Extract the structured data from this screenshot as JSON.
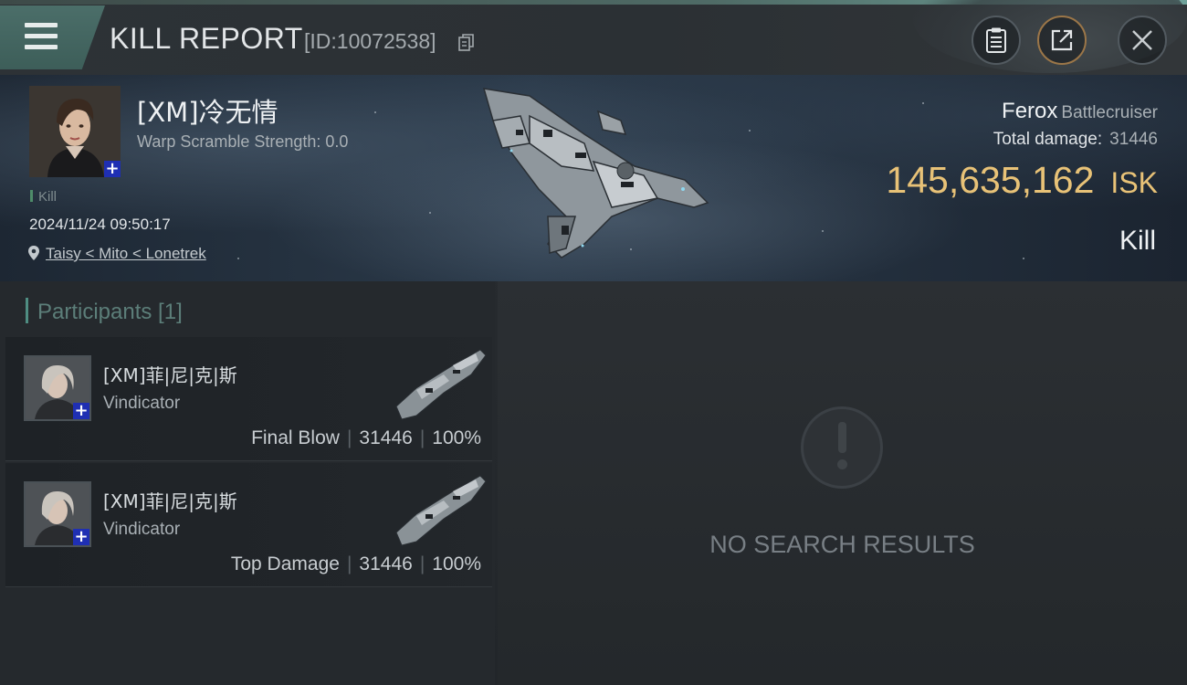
{
  "header": {
    "title": "KILL REPORT",
    "report_id": "[ID:10072538]"
  },
  "victim": {
    "name": "[XM]冷无情",
    "warp_scramble": "Warp Scramble Strength: 0.0",
    "tag": "Kill",
    "datetime": "2024/11/24 09:50:17",
    "location": "Taisy < Mito < Lonetrek",
    "ship_name": "Ferox",
    "ship_class": "Battlecruiser",
    "total_damage_label": "Total damage:",
    "total_damage": "31446",
    "isk_value": "145,635,162",
    "isk_unit": "ISK",
    "result": "Kill"
  },
  "participants": {
    "title": "Participants [1]",
    "rows": [
      {
        "name": "[XM]菲|尼|克|斯",
        "ship": "Vindicator",
        "role": "Final Blow",
        "damage": "31446",
        "percent": "100%"
      },
      {
        "name": "[XM]菲|尼|克|斯",
        "ship": "Vindicator",
        "role": "Top Damage",
        "damage": "31446",
        "percent": "100%"
      }
    ]
  },
  "empty_state": {
    "message": "NO SEARCH RESULTS"
  },
  "colors": {
    "accent": "#4f8d82",
    "isk": "#e8c277",
    "share_border": "#9b7648"
  },
  "icons": [
    "menu-icon",
    "copy-icon",
    "clipboard-icon",
    "share-icon",
    "close-icon",
    "location-pin-icon",
    "plus-icon",
    "exclamation-icon"
  ]
}
